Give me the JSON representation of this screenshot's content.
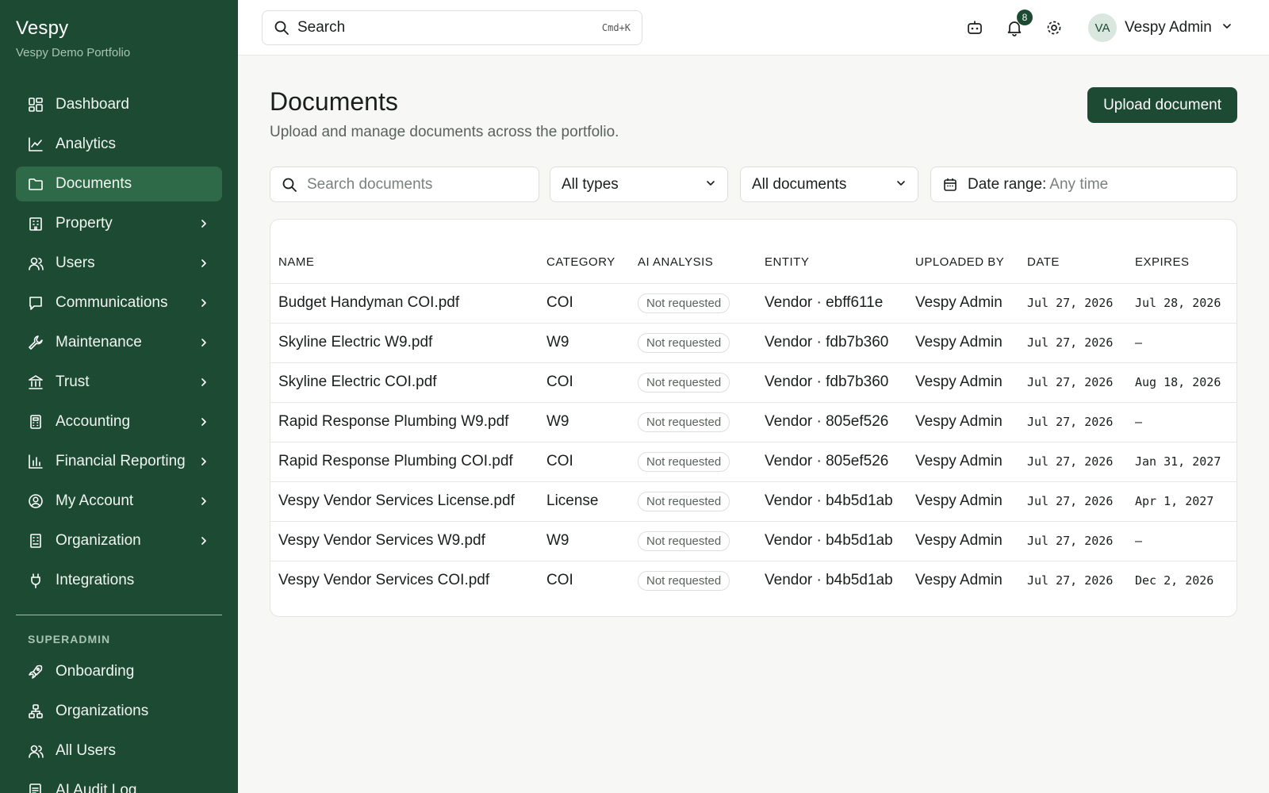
{
  "app": {
    "name": "Vespy",
    "portfolio": "Vespy Demo Portfolio"
  },
  "sidebar": {
    "items": [
      {
        "label": "Dashboard",
        "icon": "dashboard-icon",
        "chevron": false,
        "active": false
      },
      {
        "label": "Analytics",
        "icon": "chart-line-icon",
        "chevron": false,
        "active": false
      },
      {
        "label": "Documents",
        "icon": "folder-icon",
        "chevron": false,
        "active": true
      },
      {
        "label": "Property",
        "icon": "building-icon",
        "chevron": true,
        "active": false
      },
      {
        "label": "Users",
        "icon": "users-icon",
        "chevron": true,
        "active": false
      },
      {
        "label": "Communications",
        "icon": "message-icon",
        "chevron": true,
        "active": false
      },
      {
        "label": "Maintenance",
        "icon": "wrench-icon",
        "chevron": true,
        "active": false
      },
      {
        "label": "Trust",
        "icon": "bank-icon",
        "chevron": true,
        "active": false
      },
      {
        "label": "Accounting",
        "icon": "calculator-icon",
        "chevron": true,
        "active": false
      },
      {
        "label": "Financial Reporting",
        "icon": "bar-chart-icon",
        "chevron": true,
        "active": false
      },
      {
        "label": "My Account",
        "icon": "user-circle-icon",
        "chevron": true,
        "active": false
      },
      {
        "label": "Organization",
        "icon": "office-icon",
        "chevron": true,
        "active": false
      },
      {
        "label": "Integrations",
        "icon": "plug-icon",
        "chevron": false,
        "active": false
      }
    ],
    "section_label": "SUPERADMIN",
    "superadmin_items": [
      {
        "label": "Onboarding",
        "icon": "rocket-icon"
      },
      {
        "label": "Organizations",
        "icon": "hierarchy-icon"
      },
      {
        "label": "All Users",
        "icon": "users-icon"
      },
      {
        "label": "AI Audit Log",
        "icon": "log-icon"
      }
    ]
  },
  "topbar": {
    "search_placeholder": "Search",
    "search_shortcut": "Cmd+K",
    "notification_count": "8",
    "user_initials": "VA",
    "user_name": "Vespy Admin"
  },
  "page": {
    "title": "Documents",
    "subtitle": "Upload and manage documents across the portfolio.",
    "upload_label": "Upload document"
  },
  "filters": {
    "search_placeholder": "Search documents",
    "type": "All types",
    "scope": "All documents",
    "date_label": "Date range:",
    "date_value": "Any time"
  },
  "table": {
    "columns": [
      "NAME",
      "CATEGORY",
      "AI ANALYSIS",
      "ENTITY",
      "UPLOADED BY",
      "DATE",
      "EXPIRES"
    ],
    "rows": [
      {
        "name": "Budget Handyman COI.pdf",
        "category": "COI",
        "ai": "Not requested",
        "entity": "Vendor · ebff611e",
        "uploaded_by": "Vespy Admin",
        "date": "Jul 27, 2026",
        "expires": "Jul 28, 2026"
      },
      {
        "name": "Skyline Electric W9.pdf",
        "category": "W9",
        "ai": "Not requested",
        "entity": "Vendor · fdb7b360",
        "uploaded_by": "Vespy Admin",
        "date": "Jul 27, 2026",
        "expires": "—"
      },
      {
        "name": "Skyline Electric COI.pdf",
        "category": "COI",
        "ai": "Not requested",
        "entity": "Vendor · fdb7b360",
        "uploaded_by": "Vespy Admin",
        "date": "Jul 27, 2026",
        "expires": "Aug 18, 2026"
      },
      {
        "name": "Rapid Response Plumbing W9.pdf",
        "category": "W9",
        "ai": "Not requested",
        "entity": "Vendor · 805ef526",
        "uploaded_by": "Vespy Admin",
        "date": "Jul 27, 2026",
        "expires": "—"
      },
      {
        "name": "Rapid Response Plumbing COI.pdf",
        "category": "COI",
        "ai": "Not requested",
        "entity": "Vendor · 805ef526",
        "uploaded_by": "Vespy Admin",
        "date": "Jul 27, 2026",
        "expires": "Jan 31, 2027"
      },
      {
        "name": "Vespy Vendor Services License.pdf",
        "category": "License",
        "ai": "Not requested",
        "entity": "Vendor · b4b5d1ab",
        "uploaded_by": "Vespy Admin",
        "date": "Jul 27, 2026",
        "expires": "Apr 1, 2027"
      },
      {
        "name": "Vespy Vendor Services W9.pdf",
        "category": "W9",
        "ai": "Not requested",
        "entity": "Vendor · b4b5d1ab",
        "uploaded_by": "Vespy Admin",
        "date": "Jul 27, 2026",
        "expires": "—"
      },
      {
        "name": "Vespy Vendor Services COI.pdf",
        "category": "COI",
        "ai": "Not requested",
        "entity": "Vendor · b4b5d1ab",
        "uploaded_by": "Vespy Admin",
        "date": "Jul 27, 2026",
        "expires": "Dec 2, 2026"
      }
    ]
  },
  "colors": {
    "sidebar_bg": "#1c4a32",
    "active_item": "#2e6a48",
    "accent": "#1c4a32"
  }
}
